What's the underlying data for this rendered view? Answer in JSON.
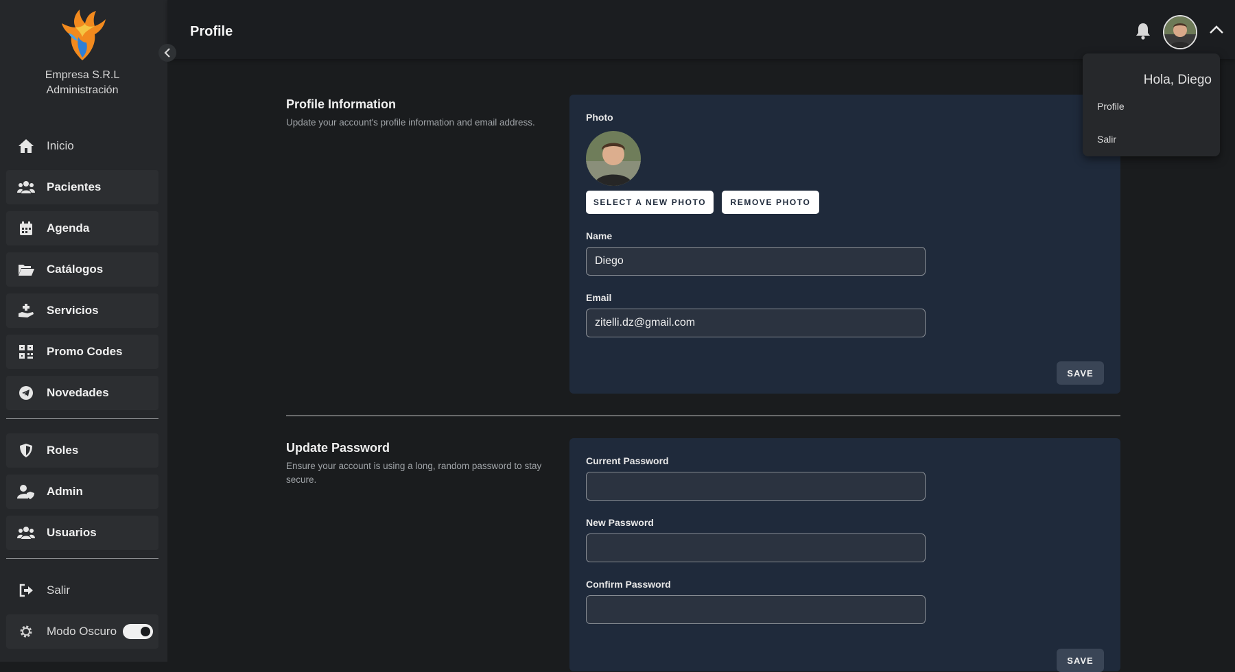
{
  "brand": {
    "line1": "Empresa S.R.L",
    "line2": "Administración"
  },
  "sidebar": {
    "items": [
      {
        "label": "Inicio",
        "icon": "home-icon"
      },
      {
        "label": "Pacientes",
        "icon": "users-icon"
      },
      {
        "label": "Agenda",
        "icon": "calendar-icon"
      },
      {
        "label": "Catálogos",
        "icon": "folder-open-icon"
      },
      {
        "label": "Servicios",
        "icon": "hand-holding-icon"
      },
      {
        "label": "Promo Codes",
        "icon": "qrcode-icon"
      },
      {
        "label": "Novedades",
        "icon": "telegram-icon"
      },
      {
        "label": "Roles",
        "icon": "shield-icon"
      },
      {
        "label": "Admin",
        "icon": "user-shield-icon"
      },
      {
        "label": "Usuarios",
        "icon": "users-icon"
      },
      {
        "label": "Salir",
        "icon": "sign-out-icon"
      },
      {
        "label": "Modo Oscuro",
        "icon": "gear-icon"
      }
    ],
    "dark_mode_on": true
  },
  "header": {
    "title": "Profile"
  },
  "user_menu": {
    "greeting": "Hola, Diego",
    "items": [
      "Profile",
      "Salir"
    ]
  },
  "profile_info": {
    "title": "Profile Information",
    "description": "Update your account's profile information and email address.",
    "photo_label": "Photo",
    "select_photo": "SELECT A NEW PHOTO",
    "remove_photo": "REMOVE PHOTO",
    "name_label": "Name",
    "name_value": "Diego",
    "email_label": "Email",
    "email_value": "zitelli.dz@gmail.com",
    "save": "SAVE"
  },
  "update_password": {
    "title": "Update Password",
    "description": "Ensure your account is using a long, random password to stay secure.",
    "current_label": "Current Password",
    "new_label": "New Password",
    "confirm_label": "Confirm Password",
    "save": "SAVE"
  },
  "colors": {
    "sidebar": "#25272a",
    "card": "#1f2a3b",
    "input": "#2b3340",
    "background": "#1a1c1e"
  }
}
